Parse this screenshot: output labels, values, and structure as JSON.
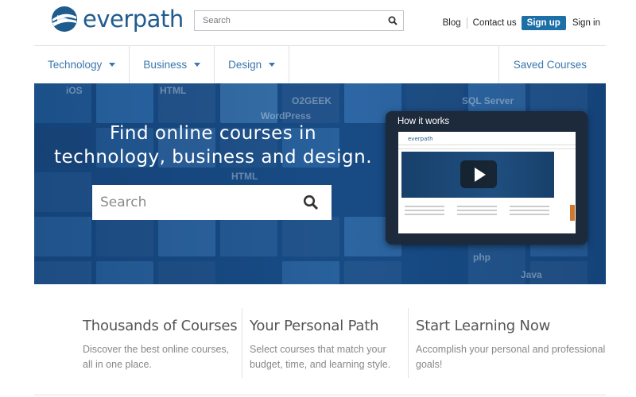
{
  "header": {
    "logo_text": "everpath",
    "search_placeholder": "Search",
    "links": {
      "blog": "Blog",
      "contact": "Contact us",
      "signup": "Sign up",
      "signin": "Sign in"
    }
  },
  "nav": {
    "items": [
      {
        "label": "Technology"
      },
      {
        "label": "Business"
      },
      {
        "label": "Design"
      }
    ],
    "saved": "Saved Courses"
  },
  "hero": {
    "title_line1": "Find online courses in",
    "title_line2": "technology, business and design.",
    "search_placeholder": "Search",
    "video_label": "How it works",
    "mini_logo": "everpath",
    "background_tiles": [
      "iOS",
      "HTML",
      "WordPress",
      "O2GEEK",
      "SQL Server",
      "HTML",
      "php",
      "Java"
    ]
  },
  "features": [
    {
      "title": "Thousands of Courses",
      "text": "Discover the best online courses, all in one place."
    },
    {
      "title": "Your Personal Path",
      "text": "Select courses that match your budget, time, and learning style."
    },
    {
      "title": "Start Learning Now",
      "text": "Accomplish your personal and professional goals!"
    }
  ],
  "colors": {
    "brand_blue": "#1f5c8e",
    "nav_link": "#3b77ad",
    "signup_bg": "#1d6fa8",
    "hero_bg": "#1a4e86"
  }
}
